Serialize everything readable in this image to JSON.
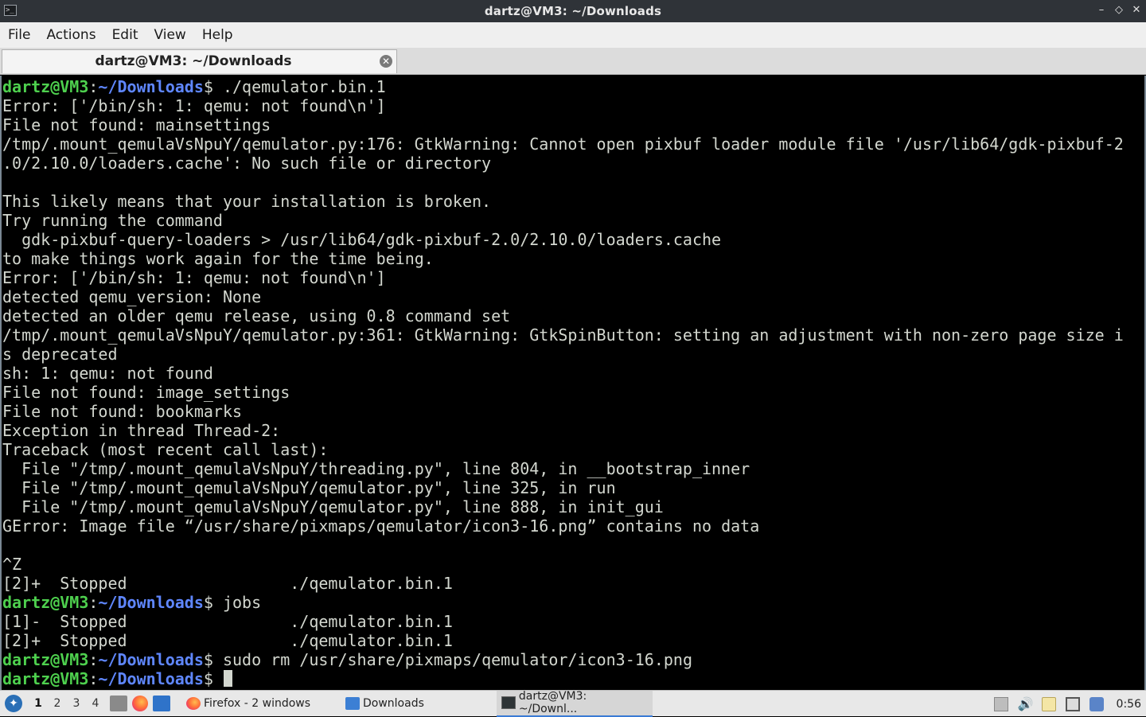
{
  "window": {
    "title": "dartz@VM3: ~/Downloads",
    "controls": [
      "–",
      "◇",
      "✕"
    ]
  },
  "menubar": {
    "items": [
      "File",
      "Actions",
      "Edit",
      "View",
      "Help"
    ]
  },
  "tabs": [
    {
      "label": "dartz@VM3: ~/Downloads",
      "close": "✕"
    }
  ],
  "terminal": {
    "prompt": {
      "user_host": "dartz@VM3",
      "colon": ":",
      "path": "~/Downloads",
      "symbol": "$ "
    },
    "lines": [
      {
        "prompt": true,
        "text": "./qemulator.bin.1"
      },
      {
        "text": "Error: ['/bin/sh: 1: qemu: not found\\n']"
      },
      {
        "text": "File not found: mainsettings"
      },
      {
        "text": "/tmp/.mount_qemulaVsNpuY/qemulator.py:176: GtkWarning: Cannot open pixbuf loader module file '/usr/lib64/gdk-pixbuf-2"
      },
      {
        "text": ".0/2.10.0/loaders.cache': No such file or directory"
      },
      {
        "text": ""
      },
      {
        "text": "This likely means that your installation is broken."
      },
      {
        "text": "Try running the command"
      },
      {
        "text": "  gdk-pixbuf-query-loaders > /usr/lib64/gdk-pixbuf-2.0/2.10.0/loaders.cache"
      },
      {
        "text": "to make things work again for the time being."
      },
      {
        "text": "Error: ['/bin/sh: 1: qemu: not found\\n']"
      },
      {
        "text": "detected qemu_version: None"
      },
      {
        "text": "detected an older qemu release, using 0.8 command set"
      },
      {
        "text": "/tmp/.mount_qemulaVsNpuY/qemulator.py:361: GtkWarning: GtkSpinButton: setting an adjustment with non-zero page size i"
      },
      {
        "text": "s deprecated"
      },
      {
        "text": "sh: 1: qemu: not found"
      },
      {
        "text": "File not found: image_settings"
      },
      {
        "text": "File not found: bookmarks"
      },
      {
        "text": "Exception in thread Thread-2:"
      },
      {
        "text": "Traceback (most recent call last):"
      },
      {
        "text": "  File \"/tmp/.mount_qemulaVsNpuY/threading.py\", line 804, in __bootstrap_inner"
      },
      {
        "text": "  File \"/tmp/.mount_qemulaVsNpuY/qemulator.py\", line 325, in run"
      },
      {
        "text": "  File \"/tmp/.mount_qemulaVsNpuY/qemulator.py\", line 888, in init_gui"
      },
      {
        "text": "GError: Image file “/usr/share/pixmaps/qemulator/icon3-16.png” contains no data"
      },
      {
        "text": ""
      },
      {
        "text": "^Z"
      },
      {
        "text": "[2]+  Stopped                 ./qemulator.bin.1"
      },
      {
        "prompt": true,
        "text": "jobs"
      },
      {
        "text": "[1]-  Stopped                 ./qemulator.bin.1"
      },
      {
        "text": "[2]+  Stopped                 ./qemulator.bin.1"
      },
      {
        "prompt": true,
        "text": "sudo rm /usr/share/pixmaps/qemulator/icon3-16.png"
      },
      {
        "prompt": true,
        "text": "",
        "cursor": true
      }
    ]
  },
  "taskbar": {
    "workspaces": [
      "1",
      "2",
      "3",
      "4"
    ],
    "active_workspace": "1",
    "quicklaunch_icons": [
      "file-manager-icon",
      "firefox-icon",
      "show-desktop-icon"
    ],
    "tasks": [
      {
        "icon": "firefox-icon",
        "label": "Firefox - 2 windows"
      },
      {
        "icon": "folder-icon",
        "label": "Downloads"
      },
      {
        "icon": "terminal-icon",
        "label": "dartz@VM3: ~/Downl..."
      }
    ],
    "tray_icons": [
      "eject-icon",
      "volume-icon",
      "clipboard-icon",
      "network-icon",
      "update-icon"
    ],
    "clock": "0:56"
  },
  "colors": {
    "terminal_bg": "#000000",
    "terminal_fg": "#d3d7cf",
    "prompt_user": "#4ed04e",
    "prompt_path": "#5f87ff",
    "titlebar_bg": "#2f3338"
  }
}
